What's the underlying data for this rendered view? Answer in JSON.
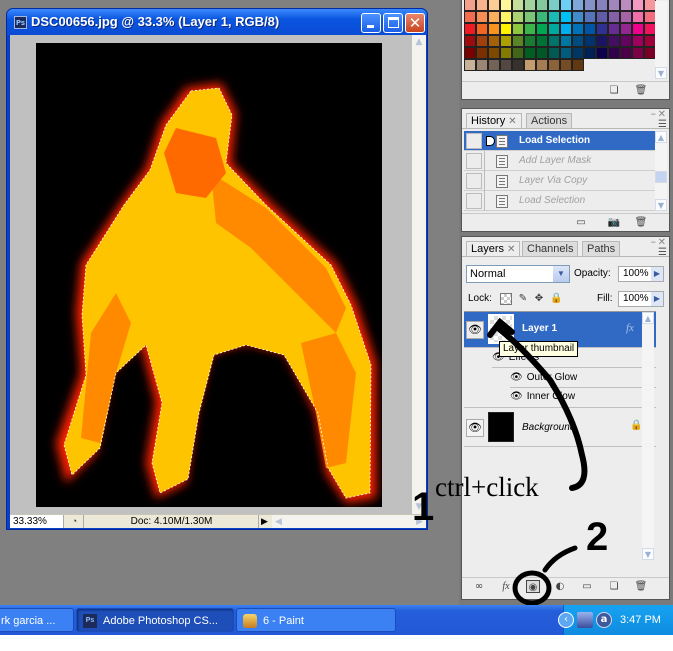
{
  "document_window": {
    "title": "DSC00656.jpg @ 33.3% (Layer 1, RGB/8)",
    "app_icon": "Ps",
    "zoom_level": "33.33%",
    "doc_size": "Doc: 4.10M/1.30M",
    "buttons": {
      "minimize": "minimize",
      "maximize": "maximize",
      "close": "close"
    }
  },
  "swatches": {
    "rows": [
      [
        "#f4a08c",
        "#f6b38e",
        "#fbcc93",
        "#fff79a",
        "#c4df9b",
        "#a3d39c",
        "#82ca9c",
        "#7accc8",
        "#6dcff6",
        "#7da7d9",
        "#8393ca",
        "#8781bd",
        "#a186be",
        "#bd8cbf",
        "#f49ac1",
        "#f5989d"
      ],
      [
        "#f26c4f",
        "#f68e55",
        "#fbaf5c",
        "#fff467",
        "#acd372",
        "#7cc576",
        "#3bb878",
        "#1abbb4",
        "#00bff3",
        "#438ccb",
        "#5574b9",
        "#605ca8",
        "#855fa8",
        "#a763a8",
        "#f06ea9",
        "#f26d7d"
      ],
      [
        "#ed1c24",
        "#f26522",
        "#f7941d",
        "#fff200",
        "#8dc73f",
        "#39b54a",
        "#00a651",
        "#00a99d",
        "#00aeef",
        "#0072bc",
        "#0054a6",
        "#2e3192",
        "#662d91",
        "#92278f",
        "#ec008c",
        "#ed145b"
      ],
      [
        "#9e0b0f",
        "#a0410d",
        "#a36209",
        "#aba000",
        "#598527",
        "#1a7b30",
        "#007236",
        "#00746b",
        "#0076a3",
        "#004b80",
        "#003471",
        "#1b1464",
        "#440e62",
        "#630460",
        "#9e005d",
        "#9e0039"
      ],
      [
        "#790000",
        "#7b2e00",
        "#7d4900",
        "#827b00",
        "#406618",
        "#005e20",
        "#005826",
        "#005952",
        "#005b7f",
        "#003663",
        "#002157",
        "#0d004c",
        "#32004b",
        "#4b0049",
        "#7b0046",
        "#7a0026"
      ],
      [
        "#c7b299",
        "#998675",
        "#736357",
        "#534741",
        "#37302d",
        "#c69c6d",
        "#a67c52",
        "#8c6239",
        "#754c24",
        "#603913"
      ]
    ]
  },
  "history_panel": {
    "tabs": [
      {
        "label": "History",
        "active": true
      },
      {
        "label": "Actions",
        "active": false
      }
    ],
    "items": [
      {
        "label": "Load Selection",
        "active": true
      },
      {
        "label": "Add Layer Mask",
        "active": false
      },
      {
        "label": "Layer Via Copy",
        "active": false
      },
      {
        "label": "Load Selection",
        "active": false
      }
    ]
  },
  "layers_panel": {
    "tabs": [
      {
        "label": "Layers",
        "active": true
      },
      {
        "label": "Channels",
        "active": false
      },
      {
        "label": "Paths",
        "active": false
      }
    ],
    "blend_mode": "Normal",
    "opacity_label": "Opacity:",
    "opacity_value": "100%",
    "lock_label": "Lock:",
    "fill_label": "Fill:",
    "fill_value": "100%",
    "layers": [
      {
        "name": "Layer 1",
        "selected": true,
        "fx": "fx",
        "effects_label": "Effects",
        "effects": [
          "Outer Glow",
          "Inner Glow"
        ]
      },
      {
        "name": "Background",
        "selected": false,
        "locked": true
      }
    ],
    "tooltip": "Layer thumbnail"
  },
  "annotations": {
    "step1_number": "1",
    "step1_text": "ctrl+click",
    "step2_number": "2"
  },
  "taskbar": {
    "buttons": [
      {
        "label": "rk garcia ...",
        "active": false
      },
      {
        "label": "Adobe Photoshop CS...",
        "icon": "Ps",
        "active": true
      },
      {
        "label": "6 - Paint",
        "active": false
      }
    ],
    "clock": "3:47 PM"
  }
}
